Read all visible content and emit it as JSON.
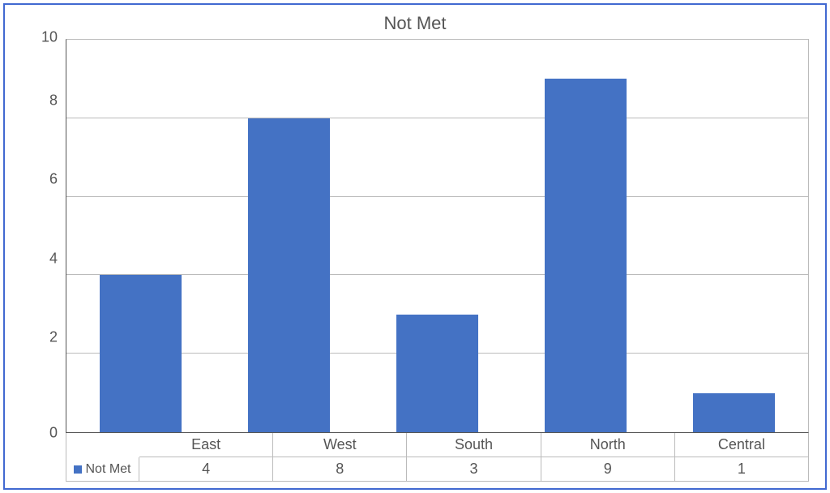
{
  "chart_data": {
    "type": "bar",
    "title": "Not Met",
    "categories": [
      "East",
      "West",
      "South",
      "North",
      "Central"
    ],
    "values": [
      4,
      8,
      3,
      9,
      1
    ],
    "series_name": "Not Met",
    "ylim": [
      0,
      10
    ],
    "yticks": [
      0,
      2,
      4,
      6,
      8,
      10
    ],
    "bar_color": "#4472c4"
  }
}
